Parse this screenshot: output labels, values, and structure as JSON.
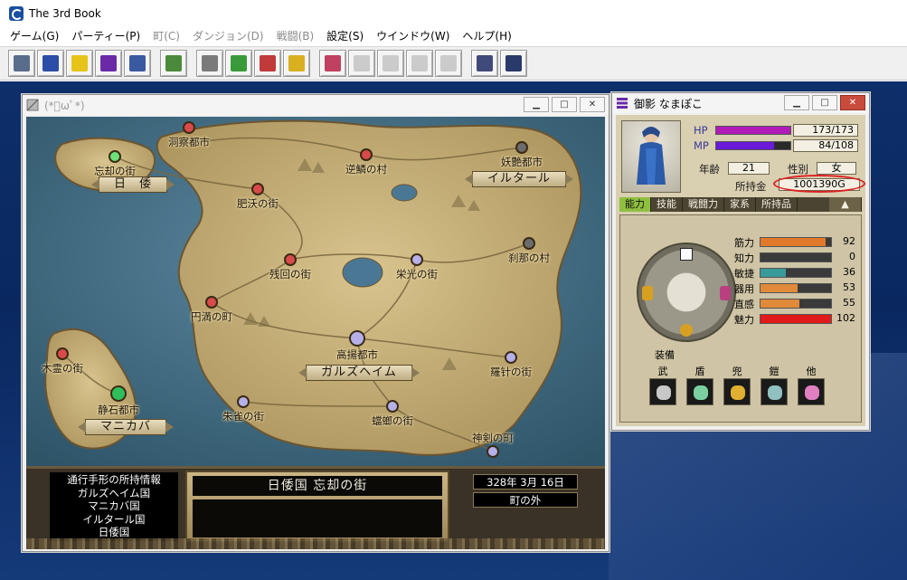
{
  "app": {
    "title": "The 3rd Book"
  },
  "menu": [
    {
      "label": "ゲーム(G)",
      "enabled": true
    },
    {
      "label": "パーティー(P)",
      "enabled": true
    },
    {
      "label": "町(C)",
      "enabled": false
    },
    {
      "label": "ダンジョン(D)",
      "enabled": false
    },
    {
      "label": "戦闘(B)",
      "enabled": false
    },
    {
      "label": "設定(S)",
      "enabled": true
    },
    {
      "label": "ウインドウ(W)",
      "enabled": true
    },
    {
      "label": "ヘルプ(H)",
      "enabled": true
    }
  ],
  "toolbar": [
    {
      "icon": "window-icon",
      "color": "#5a6c8c",
      "dim": false
    },
    {
      "icon": "notebook-icon",
      "color": "#2b4da6",
      "dim": false
    },
    {
      "icon": "pencil-icon",
      "color": "#e6c419",
      "dim": false
    },
    {
      "icon": "list-icon",
      "color": "#6a2aa8",
      "dim": false
    },
    {
      "icon": "frame-icon",
      "color": "#3a5aa0",
      "dim": false
    },
    {
      "icon": "gear-icon",
      "color": "#4a8a3a",
      "dim": false
    },
    {
      "icon": "document-icon",
      "color": "#7a7a7a",
      "dim": false
    },
    {
      "icon": "tree-icon",
      "color": "#3a9a3a",
      "dim": false
    },
    {
      "icon": "paint-icon",
      "color": "#c03a3a",
      "dim": false
    },
    {
      "icon": "wand-icon",
      "color": "#d8b020",
      "dim": false
    },
    {
      "icon": "gift-icon",
      "color": "#c04060",
      "dim": false
    },
    {
      "icon": "speech-icon",
      "color": "#9a9a9a",
      "dim": true
    },
    {
      "icon": "slash-icon",
      "color": "#9a9a9a",
      "dim": true
    },
    {
      "icon": "ball-icon",
      "color": "#9a9a9a",
      "dim": true
    },
    {
      "icon": "papers-icon",
      "color": "#9a9a9a",
      "dim": true
    },
    {
      "icon": "keyboard-icon",
      "color": "#404a7a",
      "dim": false
    },
    {
      "icon": "help-icon",
      "color": "#2a3a6a",
      "dim": false
    }
  ],
  "map_window": {
    "title": "(*ﾟωﾟ*)",
    "cities": [
      {
        "name": "洞察都市",
        "color": "#d94a4a"
      },
      {
        "name": "逆鱗の村",
        "color": "#d94a4a"
      },
      {
        "name": "妖艶都市",
        "color": "#6c6c6c"
      },
      {
        "name": "忘却の街",
        "color": "#6ee07a"
      },
      {
        "name": "肥沃の街",
        "color": "#d94a4a"
      },
      {
        "name": "刹那の村",
        "color": "#6c6c6c"
      },
      {
        "name": "残回の街",
        "color": "#d94a4a"
      },
      {
        "name": "栄光の街",
        "color": "#b6b0e8"
      },
      {
        "name": "円満の町",
        "color": "#d94a4a"
      },
      {
        "name": "高揚都市",
        "color": "#b6b0e8"
      },
      {
        "name": "木霊の街",
        "color": "#d94a4a"
      },
      {
        "name": "羅针の街",
        "color": "#b6b0e8"
      },
      {
        "name": "静石都市",
        "color": "#2fbf5a"
      },
      {
        "name": "朱雀の街",
        "color": "#b6b0e8"
      },
      {
        "name": "蟷螂の街",
        "color": "#b6b0e8"
      },
      {
        "name": "神剣の町",
        "color": "#b6b0e8"
      }
    ],
    "regions": [
      "日　倭",
      "イルタール",
      "ガルズヘイム",
      "マニカバ"
    ],
    "permits": {
      "title": "通行手形の所持情報",
      "items": [
        "ガルズヘイム国",
        "マニカバ国",
        "イルタール国",
        "日倭国"
      ]
    },
    "location": "日倭国 忘却の街",
    "date": "328年 3月 16日",
    "place": "町の外"
  },
  "char_window": {
    "title": "御影 なまぽこ",
    "hp_label": "HP",
    "hp": "173/173",
    "hp_ratio": 1.0,
    "mp_label": "MP",
    "mp": "84/108",
    "mp_ratio": 0.78,
    "age_label": "年齢",
    "age": "21",
    "gender_label": "性別",
    "gender": "女",
    "gold_label": "所持金",
    "gold": "1001390G",
    "tabs": [
      "能力",
      "技能",
      "戦闘力",
      "家系",
      "所持品"
    ],
    "up_label": "▲",
    "params": [
      {
        "label": "筋力",
        "value": "92",
        "ratio": 0.92,
        "color": "#e07a2a"
      },
      {
        "label": "知力",
        "value": "0",
        "ratio": 0.0,
        "color": "#3a9a9a"
      },
      {
        "label": "敏捷",
        "value": "36",
        "ratio": 0.36,
        "color": "#3a9a9a"
      },
      {
        "label": "器用",
        "value": "53",
        "ratio": 0.53,
        "color": "#e08a3a"
      },
      {
        "label": "直感",
        "value": "55",
        "ratio": 0.55,
        "color": "#e08a3a"
      },
      {
        "label": "魅力",
        "value": "102",
        "ratio": 1.0,
        "color": "#e01a1a"
      }
    ],
    "equip_title": "装備",
    "equip": [
      {
        "label": "武",
        "icon": "sword-icon",
        "color": "#c8c8c8"
      },
      {
        "label": "盾",
        "icon": "shield-icon",
        "color": "#7ad0a0"
      },
      {
        "label": "兜",
        "icon": "helmet-icon",
        "color": "#e0b030"
      },
      {
        "label": "鎧",
        "icon": "armor-icon",
        "color": "#90c0c0"
      },
      {
        "label": "他",
        "icon": "charm-icon",
        "color": "#e080c0"
      }
    ]
  }
}
